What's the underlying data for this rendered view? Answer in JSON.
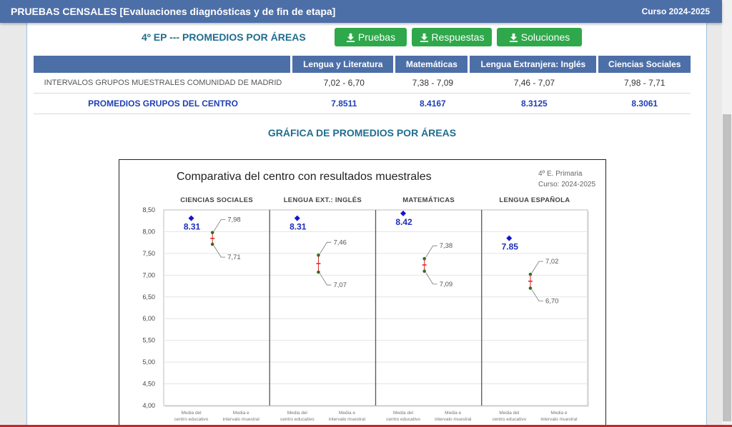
{
  "header": {
    "title": "PRUEBAS CENSALES [Evaluaciones diagnósticas y de fin de etapa]",
    "course": "Curso 2024-2025"
  },
  "main": {
    "heading": "4º EP --- PROMEDIOS POR ÁREAS",
    "buttons": {
      "pruebas": "Pruebas",
      "respuestas": "Respuestas",
      "soluciones": "Soluciones"
    },
    "table": {
      "headers": [
        "",
        "Lengua y Literatura",
        "Matemáticas",
        "Lengua Extranjera: Inglés",
        "Ciencias Sociales"
      ],
      "rows": [
        {
          "label": "INTERVALOS GRUPOS MUESTRALES COMUNIDAD DE MADRID",
          "values": [
            "7,02 - 6,70",
            "7,38 - 7,09",
            "7,46 - 7,07",
            "7,98 - 7,71"
          ]
        },
        {
          "label": "PROMEDIOS GRUPOS DEL CENTRO",
          "values": [
            "7.8511",
            "8.4167",
            "8.3125",
            "8.3061"
          ]
        }
      ]
    },
    "chart_heading": "GRÁFICA DE PROMEDIOS POR ÁREAS"
  },
  "colors": {
    "header_bg": "#4d6fa8",
    "heading_text": "#1f6d8f",
    "button_green": "#2ea84a",
    "centro_text": "#1f3fb4",
    "marker_blue": "#1414d2",
    "interval_red": "#e02020",
    "interval_green": "#3a6a2a"
  },
  "icons": {
    "button": "download-icon"
  },
  "chart_data": {
    "type": "scatter",
    "title": "Comparativa del centro con resultados muestrales",
    "subtitle": [
      "4º E. Primaria",
      "Curso: 2024-2025"
    ],
    "ylim": [
      4.0,
      8.5
    ],
    "yticks": [
      "4,00",
      "4,50",
      "5,00",
      "5,50",
      "6,00",
      "6,50",
      "7,00",
      "7,50",
      "8,00",
      "8,50"
    ],
    "grid": true,
    "xlabels": [
      "Media del centro educativo",
      "Media e intervalo muestral"
    ],
    "panels": [
      {
        "name": "CIENCIAS SOCIALES",
        "centro": 8.31,
        "centro_label": "8.31",
        "upper": 7.98,
        "lower": 7.71,
        "upper_label": "7,98",
        "lower_label": "7,71"
      },
      {
        "name": "LENGUA EXT.: INGLÉS",
        "centro": 8.31,
        "centro_label": "8.31",
        "upper": 7.46,
        "lower": 7.07,
        "upper_label": "7,46",
        "lower_label": "7,07"
      },
      {
        "name": "MATEMÁTICAS",
        "centro": 8.42,
        "centro_label": "8.42",
        "upper": 7.38,
        "lower": 7.09,
        "upper_label": "7,38",
        "lower_label": "7,09"
      },
      {
        "name": "LENGUA ESPAÑOLA",
        "centro": 7.85,
        "centro_label": "7.85",
        "upper": 7.02,
        "lower": 6.7,
        "upper_label": "7,02",
        "lower_label": "6,70"
      }
    ]
  }
}
